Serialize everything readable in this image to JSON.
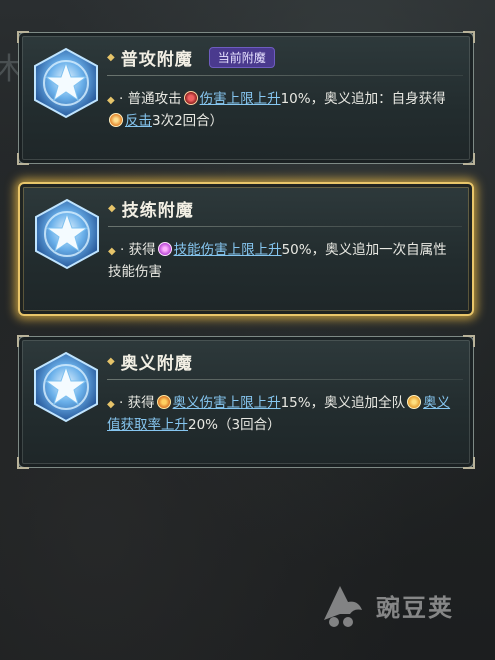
{
  "background": {
    "edge_char": "木"
  },
  "cards": [
    {
      "title": "普攻附魔",
      "badge": "当前附魔",
      "selected": false,
      "desc": {
        "prefix": "· 普通攻击",
        "link1": "伤害上限上升",
        "mid": "10%，奥义追加：自身获得",
        "link2": "反击",
        "suffix": "3次2回合）"
      }
    },
    {
      "title": "技练附魔",
      "selected": true,
      "desc": {
        "prefix": "· 获得",
        "link1": "技能伤害上限上升",
        "suffix": "50%，奥义追加一次自属性技能伤害"
      }
    },
    {
      "title": "奥义附魔",
      "selected": false,
      "desc": {
        "prefix": "· 获得",
        "link1": "奥义伤害上限上升",
        "mid": "15%，奥义追加全队",
        "link2": "奥义值获取率上升",
        "suffix": "20%（3回合）"
      }
    }
  ],
  "watermark": {
    "text": "豌豆荚"
  },
  "colors": {
    "gold_border": "#e9c66a",
    "link": "#86c6f0",
    "badge_bg": "#4a3a8e"
  }
}
